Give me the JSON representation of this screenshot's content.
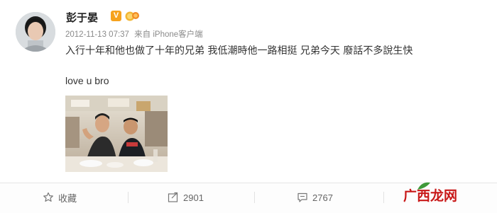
{
  "post": {
    "username": "彭于晏",
    "verified_badge": "V",
    "timestamp": "2012-11-13 07:37",
    "source": "来自 iPhone客户端",
    "text_line1": "入行十年和他也做了十年的兄弟 我低潮時他一路相挺 兄弟今天 廢話不多說生快",
    "text_line2": "love u bro"
  },
  "footer": {
    "favorite_label": "收藏",
    "repost_count": "2901",
    "comment_count": "2767"
  },
  "watermark": {
    "text": "广西龙网",
    "color": "#c81818"
  },
  "icons": {
    "favorite": "star-icon",
    "repost": "repost-icon",
    "comment": "comment-icon",
    "like": "like-icon"
  }
}
